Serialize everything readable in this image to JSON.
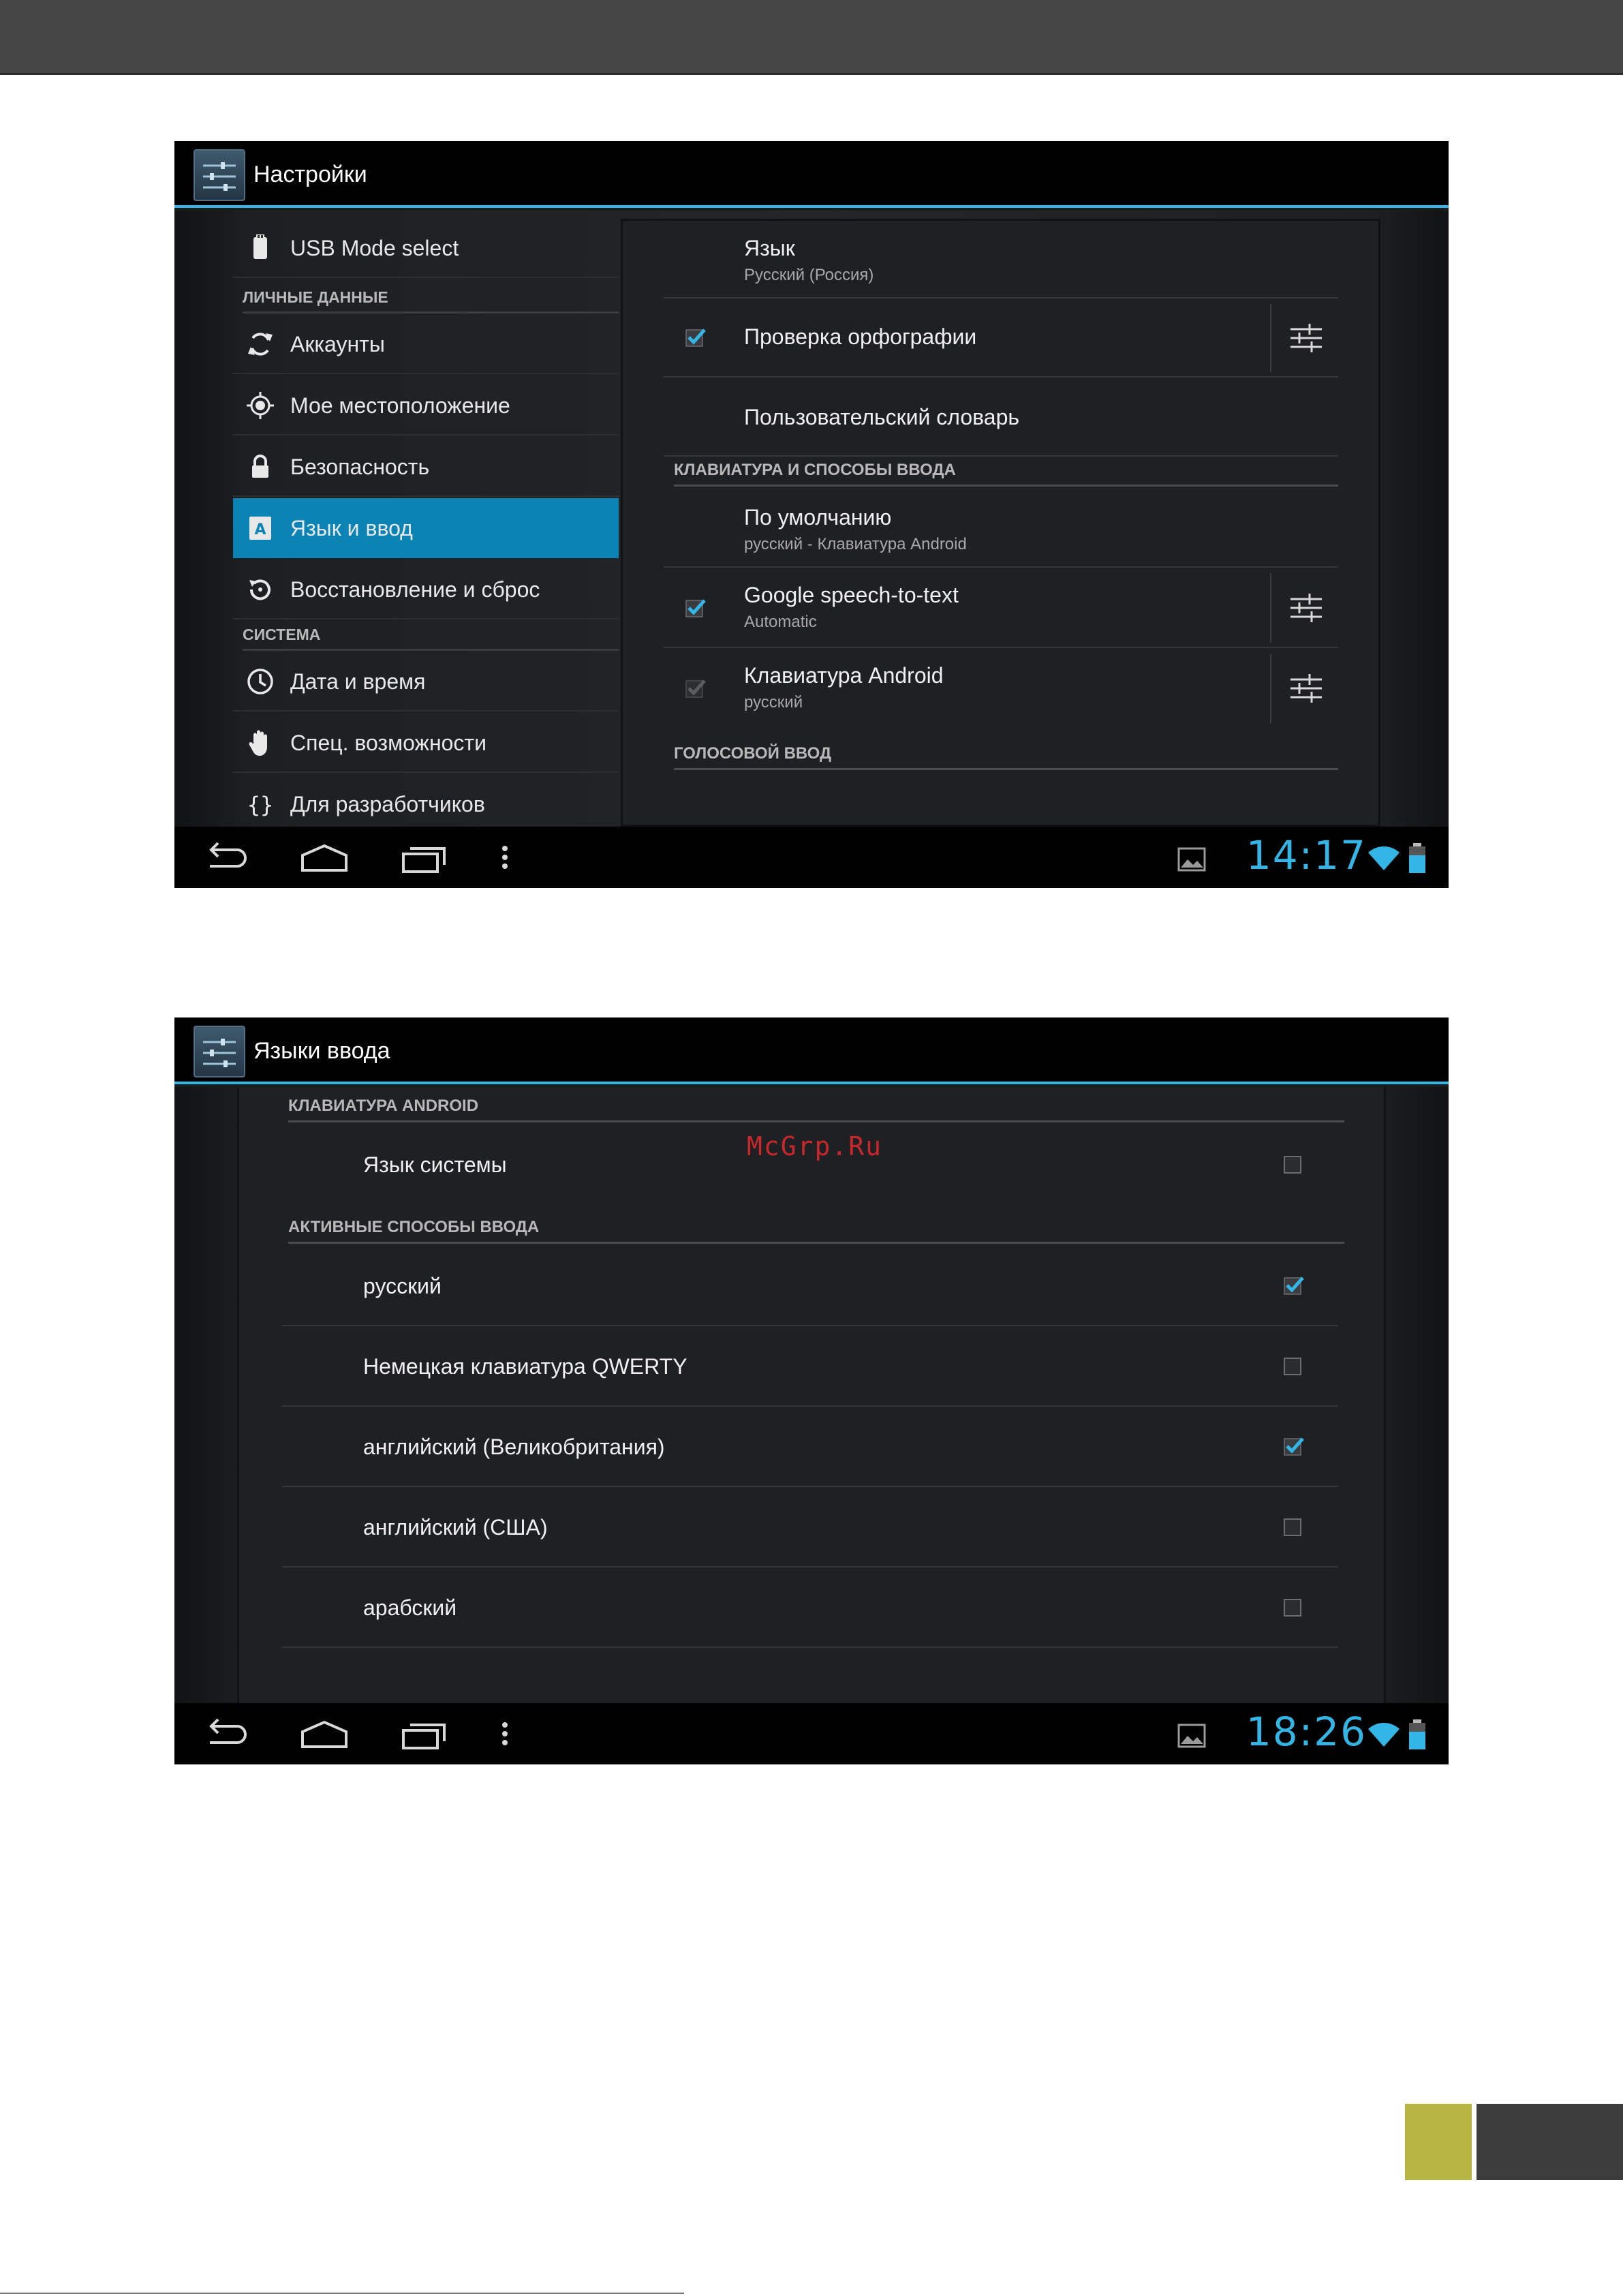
{
  "screen1": {
    "title": "Настройки",
    "clock": "14:17",
    "left_items": [
      {
        "label": "USB Mode select",
        "icon": "usb-icon"
      },
      {
        "header": "ЛИЧНЫЕ ДАННЫЕ"
      },
      {
        "label": "Аккаунты",
        "icon": "sync-icon"
      },
      {
        "label": "Мое местоположение",
        "icon": "location-icon"
      },
      {
        "label": "Безопасность",
        "icon": "lock-icon"
      },
      {
        "label": "Язык и ввод",
        "icon": "language-icon",
        "selected": true
      },
      {
        "label": "Восстановление и сброс",
        "icon": "restore-icon"
      },
      {
        "header": "СИСТЕМА"
      },
      {
        "label": "Дата и время",
        "icon": "clock-icon"
      },
      {
        "label": "Спец. возможности",
        "icon": "hand-icon"
      },
      {
        "label": "Для разработчиков",
        "icon": "braces-icon"
      }
    ],
    "right_items": {
      "language_title": "Язык",
      "language_value": "Русский (Россия)",
      "spellcheck_label": "Проверка орфографии",
      "spellcheck_checked": true,
      "user_dictionary": "Пользовательский словарь",
      "keyboard_header": "КЛАВИАТУРА И СПОСОБЫ ВВОДА",
      "default_title": "По умолчанию",
      "default_value": "русский - Клавиатура Android",
      "google_title": "Google speech-to-text",
      "google_value": "Automatic",
      "google_checked": true,
      "android_kb_title": "Клавиатура Android",
      "android_kb_value": "русский",
      "android_kb_checked": true,
      "voice_header": "ГОЛОСОВОЙ ВВОД"
    }
  },
  "screen2": {
    "title": "Языки ввода",
    "clock": "18:26",
    "header_android": "КЛАВИАТУРА ANDROID",
    "system_language": "Язык системы",
    "system_language_checked": false,
    "header_active": "АКТИВНЫЕ СПОСОБЫ ВВОДА",
    "methods": [
      {
        "label": "русский",
        "checked": true
      },
      {
        "label": "Немецкая клавиатура QWERTY",
        "checked": false
      },
      {
        "label": "английский (Великобритания)",
        "checked": true
      },
      {
        "label": "английский (США)",
        "checked": false
      },
      {
        "label": "арабский",
        "checked": false
      }
    ]
  },
  "watermark": "McGrp.Ru",
  "colors": {
    "accent": "#33b5e5",
    "selected_row": "#0b83b5",
    "olive_block": "#b6b442"
  }
}
